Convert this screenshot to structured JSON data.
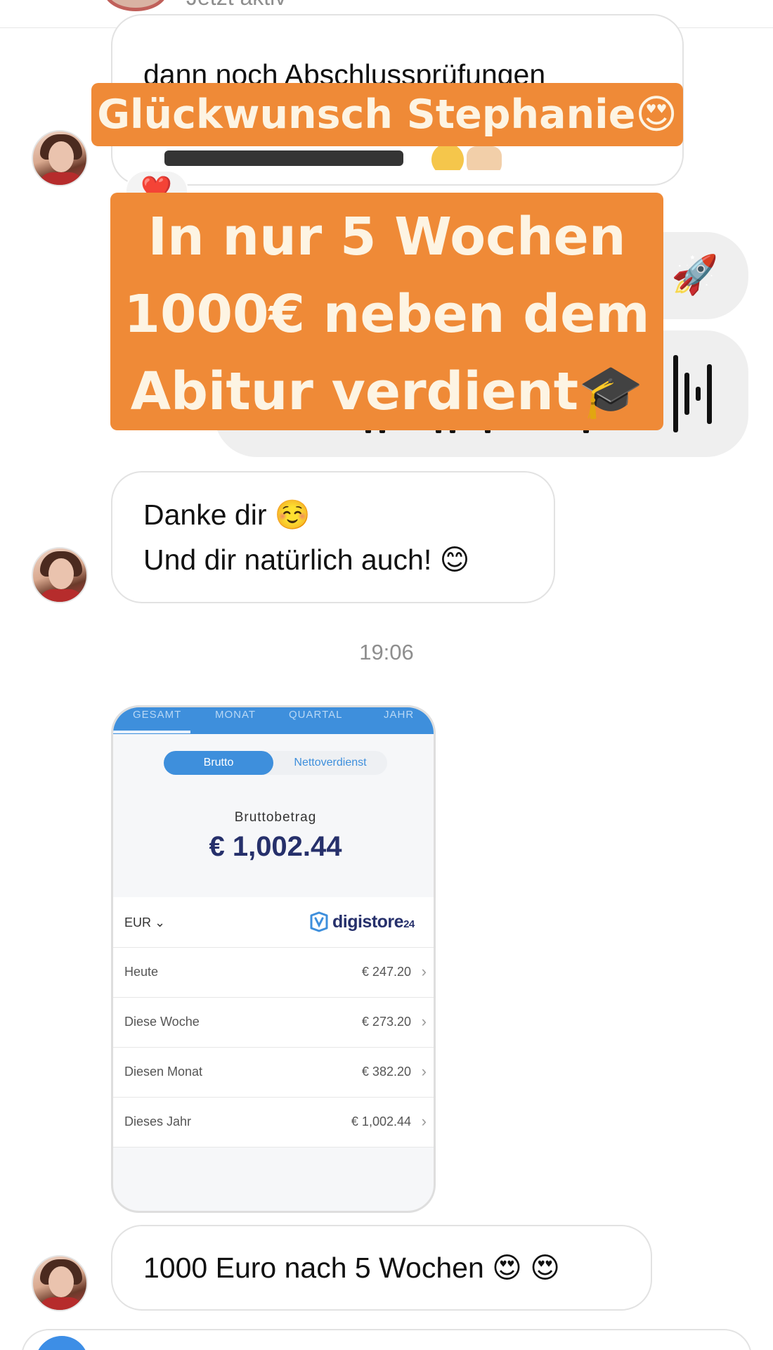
{
  "header": {
    "status": "Jetzt aktiv"
  },
  "messages": {
    "m1": {
      "text": "dann noch Abschlussprüfungen"
    },
    "m2": {
      "text": "Danke dir ☺️\nUnd dir natürlich auch! 😊"
    },
    "m3": {
      "text": "1000 Euro nach 5 Wochen 😍 😍"
    }
  },
  "reaction": {
    "emoji": "❤️"
  },
  "rocket": {
    "emoji": "🚀"
  },
  "overlays": {
    "top": "Glückwunsch Stephanie😍",
    "main_line1": "In nur 5 Wochen",
    "main_line2": "1000€ neben dem",
    "main_line3": "Abitur verdient🎓"
  },
  "timestamp": "19:06",
  "screenshot": {
    "tabs": [
      "GESAMT",
      "MONAT",
      "QUARTAL",
      "JAHR"
    ],
    "toggle": {
      "active": "Brutto",
      "inactive": "Nettoverdienst"
    },
    "gross_label": "Bruttobetrag",
    "gross_value": "€ 1,002.44",
    "currency": "EUR ⌄",
    "logo": {
      "name": "digistore",
      "suffix": "24"
    },
    "rows": [
      {
        "label": "Heute",
        "value": "€ 247.20"
      },
      {
        "label": "Diese Woche",
        "value": "€ 273.20"
      },
      {
        "label": "Diesen Monat",
        "value": "€ 382.20"
      },
      {
        "label": "Dieses Jahr",
        "value": "€ 1,002.44"
      }
    ]
  },
  "colors": {
    "overlay": "#ef8a37",
    "accent_blue": "#3e8fdc",
    "amount_navy": "#26306b"
  }
}
